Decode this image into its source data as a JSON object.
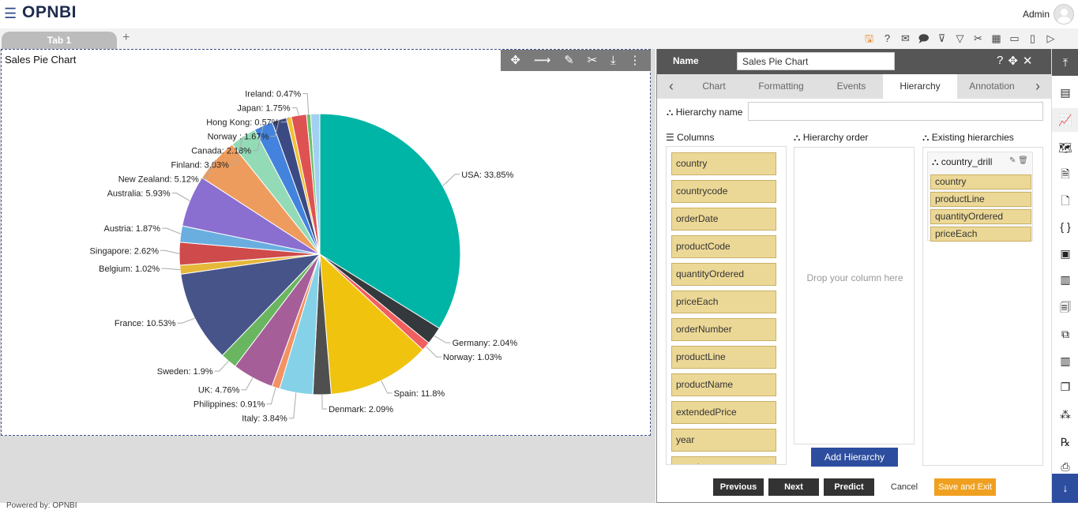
{
  "app": {
    "logo": "OPNBI",
    "user": "Admin",
    "footer": "Powered by: OPNBI"
  },
  "tabs": [
    {
      "label": "Tab 1"
    }
  ],
  "tab_add": "+",
  "toolbar_icons": [
    "save-icon",
    "help-icon",
    "mail-icon",
    "comment-icon",
    "clear-filter-icon",
    "filter-icon",
    "settings-icon",
    "table-icon",
    "screen-icon",
    "devices-icon",
    "play-icon"
  ],
  "widget": {
    "title": "Sales Pie Chart",
    "tools": [
      "move-icon",
      "link-icon",
      "edit-icon",
      "tools-icon",
      "download-icon",
      "more-icon"
    ]
  },
  "chart_data": {
    "type": "pie",
    "slices": [
      {
        "label": "USA: 33.85%",
        "name": "USA",
        "value": 33.85,
        "color": "#00b5a6"
      },
      {
        "label": "Germany: 2.04%",
        "name": "Germany",
        "value": 2.04,
        "color": "#34393d"
      },
      {
        "label": "Norway: 1.03%",
        "name": "Norway",
        "value": 1.03,
        "color": "#f15f5f"
      },
      {
        "label": "Spain: 11.8%",
        "name": "Spain",
        "value": 11.8,
        "color": "#f0c30e"
      },
      {
        "label": "Denmark: 2.09%",
        "name": "Denmark",
        "value": 2.09,
        "color": "#4f4f4f"
      },
      {
        "label": "Italy: 3.84%",
        "name": "Italy",
        "value": 3.84,
        "color": "#85d2e8"
      },
      {
        "label": "Philippines: 0.91%",
        "name": "Philippines",
        "value": 0.91,
        "color": "#f39262"
      },
      {
        "label": "UK: 4.76%",
        "name": "UK",
        "value": 4.76,
        "color": "#a65e99"
      },
      {
        "label": "Sweden: 1.9%",
        "name": "Sweden",
        "value": 1.9,
        "color": "#6ab660"
      },
      {
        "label": "France: 10.53%",
        "name": "France",
        "value": 10.53,
        "color": "#47548a"
      },
      {
        "label": "Belgium: 1.02%",
        "name": "Belgium",
        "value": 1.02,
        "color": "#e6b838"
      },
      {
        "label": "Singapore: 2.62%",
        "name": "Singapore",
        "value": 2.62,
        "color": "#cf4a4a"
      },
      {
        "label": "Austria: 1.87%",
        "name": "Austria",
        "value": 1.87,
        "color": "#6aaee0"
      },
      {
        "label": "Australia: 5.93%",
        "name": "Australia",
        "value": 5.93,
        "color": "#8a6fd1"
      },
      {
        "label": "New Zealand: 5.12%",
        "name": "New Zealand",
        "value": 5.12,
        "color": "#ee9c5d"
      },
      {
        "label": "Finland: 3.03%",
        "name": "Finland",
        "value": 3.03,
        "color": "#93dbb7"
      },
      {
        "label": "Canada: 2.18%",
        "name": "Canada",
        "value": 2.18,
        "color": "#4383de"
      },
      {
        "label": "Norway : 1.67%",
        "name": "Norway ",
        "value": 1.67,
        "color": "#3c4a84"
      },
      {
        "label": "Hong Kong: 0.57%",
        "name": "Hong Kong",
        "value": 0.57,
        "color": "#f2c12e"
      },
      {
        "label": "Japan: 1.75%",
        "name": "Japan",
        "value": 1.75,
        "color": "#df5252"
      },
      {
        "label": "Ireland: 0.47%",
        "name": "Ireland",
        "value": 0.47,
        "color": "#68c26f"
      },
      {
        "label": "",
        "name": "",
        "value": 1.05,
        "color": "#a3d0f0"
      }
    ]
  },
  "panel": {
    "name_label": "Name",
    "name_value": "Sales Pie Chart",
    "head_icons": [
      "help-icon",
      "move-icon",
      "close-icon"
    ],
    "tabs": [
      "Chart",
      "Formatting",
      "Events",
      "Hierarchy",
      "Annotation"
    ],
    "active_tab": "Hierarchy",
    "hierarchy_name_label": "Hierarchy name",
    "hierarchy_name_value": "",
    "columns_title": "Columns",
    "columns": [
      "country",
      "countrycode",
      "orderDate",
      "productCode",
      "quantityOrdered",
      "priceEach",
      "orderNumber",
      "productLine",
      "productName",
      "extendedPrice",
      "year",
      "month"
    ],
    "order_title": "Hierarchy order",
    "drop_text": "Drop your column here",
    "add_button": "Add Hierarchy",
    "existing_title": "Existing hierarchies",
    "existing": [
      {
        "name": "country_drill",
        "items": [
          "country",
          "productLine",
          "quantityOrdered",
          "priceEach"
        ]
      }
    ],
    "buttons": {
      "previous": "Previous",
      "next": "Next",
      "predict": "Predict",
      "cancel": "Cancel",
      "save_exit": "Save and Exit"
    },
    "colors": {
      "dark_button": "#333333",
      "save_button": "#f0a020",
      "accent": "#2d4d9e"
    }
  },
  "sidebar_icons": [
    "collapse-up-icon",
    "table-icon",
    "chart-icon",
    "map-icon",
    "doc-icon",
    "page-icon",
    "code-icon",
    "image-icon",
    "report-icon",
    "file-icon",
    "link-icon",
    "bar-chart-icon",
    "copy-icon",
    "cubes-icon",
    "rx-icon",
    "print-icon",
    "download-icon"
  ]
}
